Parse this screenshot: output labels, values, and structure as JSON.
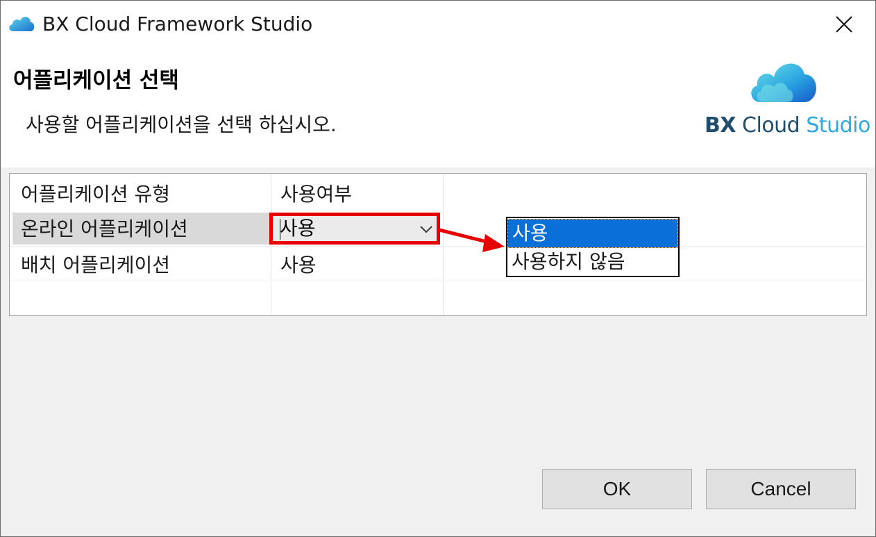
{
  "window": {
    "title": "BX Cloud Framework Studio"
  },
  "banner": {
    "title": "어플리케이션 선택",
    "description": "사용할 어플리케이션을 선택 하십시오.",
    "logo_bx": "BX",
    "logo_cloud": " Cloud ",
    "logo_studio": "Studio"
  },
  "table": {
    "headers": [
      "어플리케이션 유형",
      "사용여부"
    ],
    "rows": [
      {
        "type": "온라인 어플리케이션",
        "usage": "사용"
      },
      {
        "type": "배치 어플리케이션",
        "usage": "사용"
      }
    ]
  },
  "dropdown": {
    "options": [
      "사용",
      "사용하지 않음"
    ],
    "selected": "사용"
  },
  "buttons": {
    "ok": "OK",
    "cancel": "Cancel"
  },
  "colors": {
    "highlight": "#e60000",
    "selection": "#0a6fd8",
    "logo_dark": "#1f4e6e",
    "logo_light": "#2fa8e0"
  }
}
